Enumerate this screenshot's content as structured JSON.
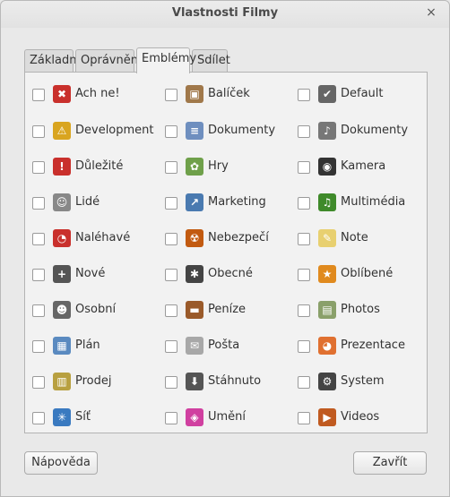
{
  "window": {
    "title": "Vlastnosti Filmy",
    "close_label": "×"
  },
  "tabs": [
    {
      "label": "Základní"
    },
    {
      "label": "Oprávnění"
    },
    {
      "label": "Emblémy"
    },
    {
      "label": "Sdílet"
    }
  ],
  "emblems": [
    {
      "label": "Ach ne!",
      "icon": "cross-icon",
      "glyph": "✖",
      "color": "#c9302c"
    },
    {
      "label": "Balíček",
      "icon": "package-icon",
      "glyph": "▣",
      "color": "#a0784a"
    },
    {
      "label": "Default",
      "icon": "checkmark-icon",
      "glyph": "✔",
      "color": "#666666"
    },
    {
      "label": "Development",
      "icon": "construction-icon",
      "glyph": "⚠",
      "color": "#d9a520"
    },
    {
      "label": "Dokumenty",
      "icon": "document-icon",
      "glyph": "≡",
      "color": "#6f8fbf"
    },
    {
      "label": "Dokumenty",
      "icon": "music-note-icon",
      "glyph": "♪",
      "color": "#777777"
    },
    {
      "label": "Důležité",
      "icon": "exclamation-icon",
      "glyph": "!",
      "color": "#c9302c"
    },
    {
      "label": "Hry",
      "icon": "games-icon",
      "glyph": "✿",
      "color": "#6fa04a"
    },
    {
      "label": "Kamera",
      "icon": "camera-icon",
      "glyph": "◉",
      "color": "#333333"
    },
    {
      "label": "Lidé",
      "icon": "people-icon",
      "glyph": "☺",
      "color": "#888888"
    },
    {
      "label": "Marketing",
      "icon": "chart-icon",
      "glyph": "↗",
      "color": "#4a7ab0"
    },
    {
      "label": "Multimédia",
      "icon": "multimedia-icon",
      "glyph": "♫",
      "color": "#3f8a2a"
    },
    {
      "label": "Naléhavé",
      "icon": "clock-icon",
      "glyph": "◔",
      "color": "#c9302c"
    },
    {
      "label": "Nebezpečí",
      "icon": "radiation-icon",
      "glyph": "☢",
      "color": "#c25a10"
    },
    {
      "label": "Note",
      "icon": "note-icon",
      "glyph": "✎",
      "color": "#e8d070"
    },
    {
      "label": "Nové",
      "icon": "plus-icon",
      "glyph": "+",
      "color": "#555555"
    },
    {
      "label": "Obecné",
      "icon": "asterisk-icon",
      "glyph": "✱",
      "color": "#444444"
    },
    {
      "label": "Oblíbené",
      "icon": "star-icon",
      "glyph": "★",
      "color": "#e08a1e"
    },
    {
      "label": "Osobní",
      "icon": "person-icon",
      "glyph": "☻",
      "color": "#666666"
    },
    {
      "label": "Peníze",
      "icon": "wallet-icon",
      "glyph": "▬",
      "color": "#9a5a2a"
    },
    {
      "label": "Photos",
      "icon": "photos-icon",
      "glyph": "▤",
      "color": "#8aa06a"
    },
    {
      "label": "Plán",
      "icon": "plan-icon",
      "glyph": "▦",
      "color": "#5a8ac0"
    },
    {
      "label": "Pošta",
      "icon": "mail-icon",
      "glyph": "✉",
      "color": "#a8a8a8"
    },
    {
      "label": "Prezentace",
      "icon": "presentation-icon",
      "glyph": "◕",
      "color": "#e07030"
    },
    {
      "label": "Prodej",
      "icon": "sale-icon",
      "glyph": "▥",
      "color": "#b8a040"
    },
    {
      "label": "Stáhnuto",
      "icon": "download-icon",
      "glyph": "⬇",
      "color": "#555555"
    },
    {
      "label": "System",
      "icon": "gear-icon",
      "glyph": "⚙",
      "color": "#444444"
    },
    {
      "label": "Síť",
      "icon": "network-icon",
      "glyph": "✳",
      "color": "#3a7ac0"
    },
    {
      "label": "Umění",
      "icon": "art-icon",
      "glyph": "◈",
      "color": "#d040a0"
    },
    {
      "label": "Videos",
      "icon": "video-icon",
      "glyph": "▶",
      "color": "#c05a20"
    }
  ],
  "buttons": {
    "help": "Nápověda",
    "close": "Zavřít"
  }
}
